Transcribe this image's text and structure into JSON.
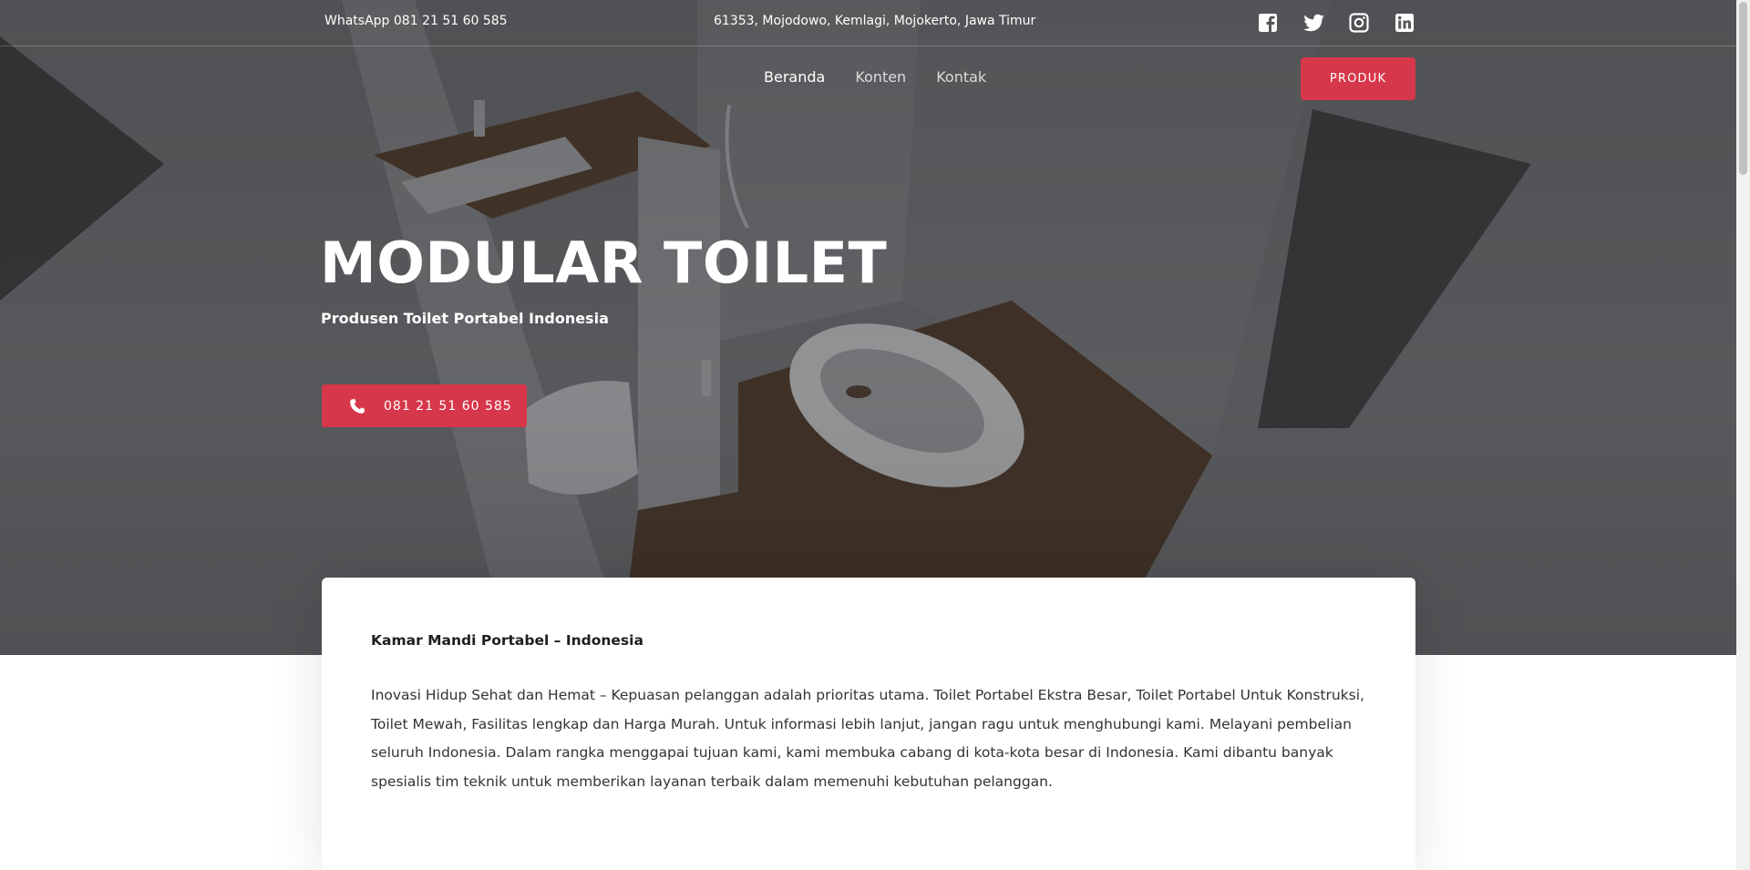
{
  "topbar": {
    "whatsapp": "WhatsApp 081 21 51 60 585",
    "address": "61353, Mojodowo, Kemlagi, Mojokerto, Jawa Timur",
    "social": [
      "facebook-icon",
      "twitter-icon",
      "instagram-icon",
      "linkedin-icon"
    ]
  },
  "nav": {
    "items": [
      {
        "label": "Beranda",
        "active": true
      },
      {
        "label": "Konten",
        "active": false
      },
      {
        "label": "Kontak",
        "active": false
      }
    ],
    "cta_label": "PRODUK"
  },
  "hero": {
    "title": "MODULAR TOILET",
    "subtitle": "Produsen Toilet Portabel Indonesia",
    "phone_label": "081 21 51 60 585"
  },
  "content": {
    "heading": "Kamar Mandi Portabel – Indonesia",
    "body": "Inovasi Hidup Sehat dan Hemat – Kepuasan pelanggan adalah prioritas utama. Toilet Portabel Ekstra Besar, Toilet Portabel Untuk Konstruksi, Toilet Mewah, Fasilitas lengkap dan Harga Murah. Untuk informasi lebih lanjut, jangan ragu untuk menghubungi kami. Melayani pembelian seluruh Indonesia. Dalam rangka menggapai tujuan kami, kami membuka cabang di kota-kota besar di Indonesia. Kami dibantu banyak spesialis tim teknik untuk memberikan layanan terbaik dalam memenuhi kebutuhan pelanggan."
  },
  "colors": {
    "accent": "#d7374a",
    "text_dark": "#1e1e1e",
    "text_body": "#333333"
  }
}
